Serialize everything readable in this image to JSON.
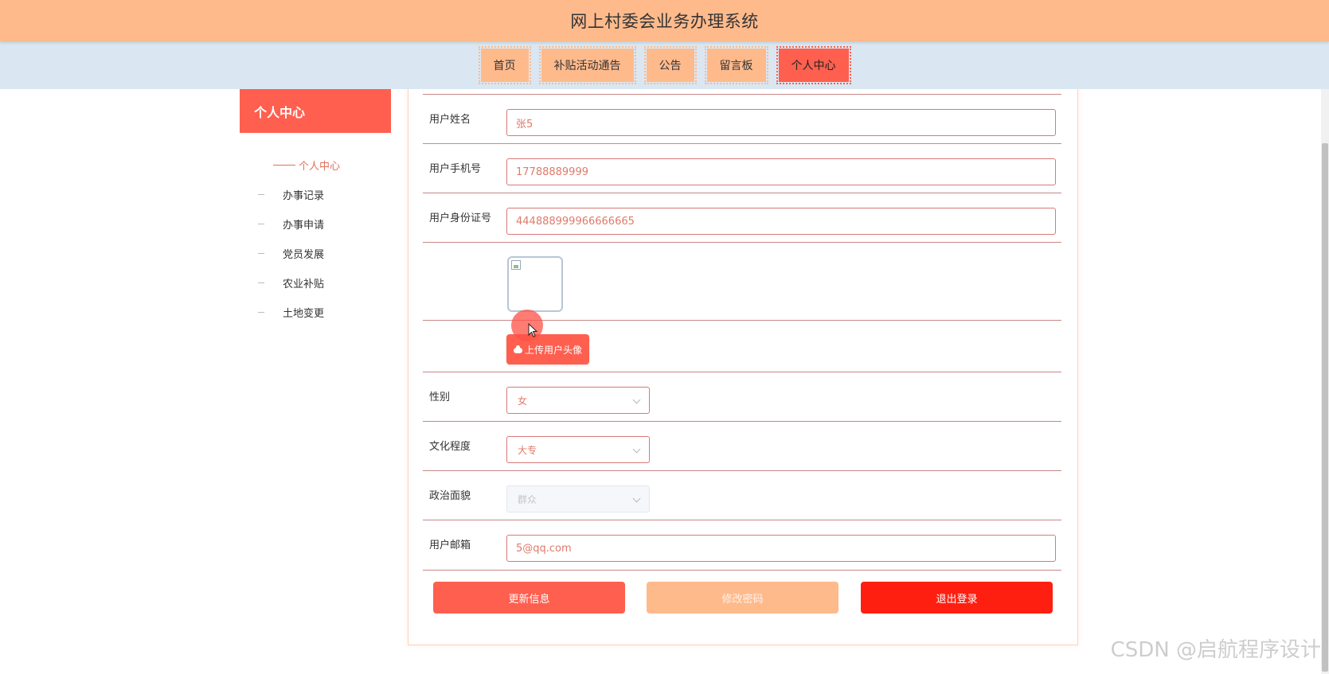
{
  "app": {
    "title": "网上村委会业务办理系统"
  },
  "nav": {
    "items": [
      {
        "label": "首页"
      },
      {
        "label": "补贴活动通告"
      },
      {
        "label": "公告"
      },
      {
        "label": "留言板"
      },
      {
        "label": "个人中心",
        "active": true
      }
    ]
  },
  "sidebar": {
    "title": "个人中心",
    "items": [
      {
        "label": "个人中心",
        "active": true
      },
      {
        "label": "办事记录"
      },
      {
        "label": "办事申请"
      },
      {
        "label": "党员发展"
      },
      {
        "label": "农业补贴"
      },
      {
        "label": "土地变更"
      }
    ]
  },
  "form": {
    "name": {
      "label": "用户姓名",
      "value": "张5"
    },
    "phone": {
      "label": "用户手机号",
      "value": "17788889999"
    },
    "id_number": {
      "label": "用户身份证号",
      "value": "444888999966666665"
    },
    "upload_label": "上传用户头像",
    "gender": {
      "label": "性别",
      "value": "女"
    },
    "education": {
      "label": "文化程度",
      "value": "大专"
    },
    "politics": {
      "label": "政治面貌",
      "value": "群众",
      "disabled": true
    },
    "email": {
      "label": "用户邮箱",
      "value": "5@qq.com"
    }
  },
  "actions": {
    "update": "更新信息",
    "password": "修改密码",
    "logout": "退出登录"
  },
  "watermark": "CSDN @启航程序设计",
  "colors": {
    "header": "#ffba8c",
    "nav_bar": "#dae7f2",
    "accent": "#ff5f4f",
    "logout": "#ff1f10"
  }
}
